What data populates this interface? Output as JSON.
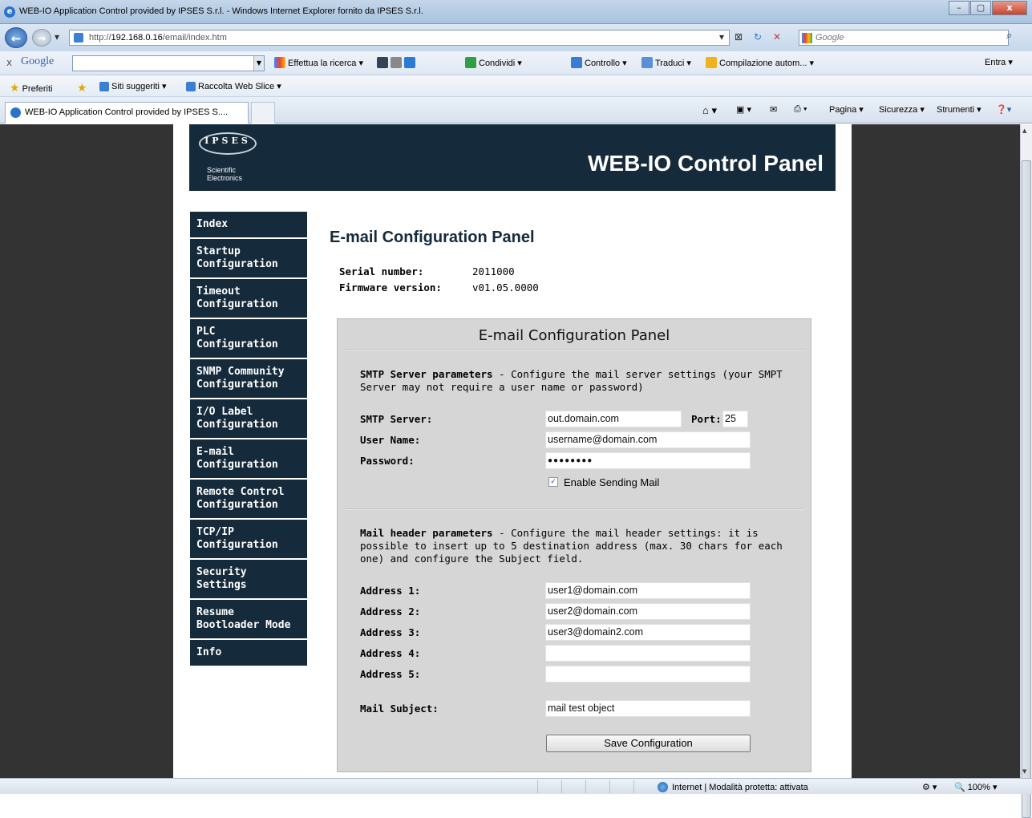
{
  "window": {
    "title": "WEB-IO Application Control provided by IPSES S.r.l. - Windows Internet Explorer fornito da IPSES S.r.l.",
    "minimize": "–",
    "maximize": "▢",
    "close": "x"
  },
  "addressbar": {
    "url_prefix": "http://",
    "url_host": "192.168.0.16",
    "url_path": "/email/index.htm",
    "search_placeholder": "Google"
  },
  "google_toolbar": {
    "close": "x",
    "logo": "Google",
    "items": [
      "Effettua la ricerca ▾",
      "Condividi ▾",
      "Controllo ▾",
      "Traduci ▾",
      "Compilazione autom... ▾",
      "Entra ▾"
    ]
  },
  "favorites": {
    "label": "Preferiti",
    "items": [
      "Siti suggeriti ▾",
      "Raccolta Web Slice ▾"
    ]
  },
  "tabs": {
    "active": "WEB-IO Application Control provided by IPSES S....",
    "commands": [
      "Pagina ▾",
      "Sicurezza ▾",
      "Strumenti ▾"
    ]
  },
  "banner": {
    "logo_word": "IPSES",
    "logo_sub1": "Scientific",
    "logo_sub2": "Electronics",
    "title": "WEB-IO Control Panel"
  },
  "nav": {
    "items": [
      {
        "l1": "Index",
        "l2": ""
      },
      {
        "l1": "Startup",
        "l2": "Configuration"
      },
      {
        "l1": "Timeout",
        "l2": "Configuration"
      },
      {
        "l1": "PLC Configuration",
        "l2": ""
      },
      {
        "l1": "SNMP Community",
        "l2": "Configuration"
      },
      {
        "l1": "I/O Label",
        "l2": "Configuration"
      },
      {
        "l1": "E-mail",
        "l2": "Configuration"
      },
      {
        "l1": "Remote Control",
        "l2": "Configuration"
      },
      {
        "l1": "TCP/IP",
        "l2": "Configuration"
      },
      {
        "l1": "Security Settings",
        "l2": ""
      },
      {
        "l1": "Resume",
        "l2": "Bootloader Mode"
      },
      {
        "l1": "Info",
        "l2": ""
      }
    ]
  },
  "content": {
    "heading": "E-mail Configuration Panel",
    "serial_label": "Serial number:",
    "serial_value": "2011000",
    "firmware_label": "Firmware version:",
    "firmware_value": "v01.05.0000"
  },
  "panel": {
    "title": "E-mail Configuration Panel",
    "smtp_heading": "SMTP Server parameters",
    "smtp_desc": " - Configure the mail server settings (your SMPT Server may not require a user name or password)",
    "smtp_server_label": "SMTP Server:",
    "smtp_server_value": "out.domain.com",
    "port_label": "Port:",
    "port_value": "25",
    "username_label": "User Name:",
    "username_value": "username@domain.com",
    "password_label": "Password:",
    "password_value": "●●●●●●●●",
    "enable_label": "Enable Sending Mail",
    "enable_checked": "✓",
    "header_heading": "Mail header parameters",
    "header_desc": " - Configure the mail header settings: it is possible to insert up to 5 destination address (max. 30 chars for each one) and configure the Subject field.",
    "address1_label": "Address 1:",
    "address1_value": "user1@domain.com",
    "address2_label": "Address 2:",
    "address2_value": "user2@domain.com",
    "address3_label": "Address 3:",
    "address3_value": "user3@domain2.com",
    "address4_label": "Address 4:",
    "address4_value": "",
    "address5_label": "Address 5:",
    "address5_value": "",
    "subject_label": "Mail Subject:",
    "subject_value": "mail test object",
    "save_button": "Save Configuration"
  },
  "statusbar": {
    "zone": "Internet | Modalità protetta: attivata",
    "zoom": "100%"
  }
}
